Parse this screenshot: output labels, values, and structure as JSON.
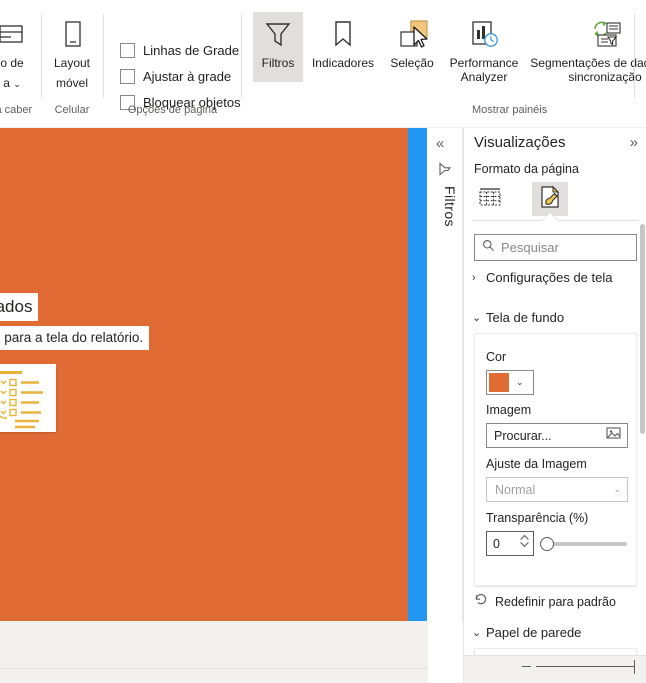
{
  "ribbon": {
    "groups": [
      {
        "label": "ra caber"
      },
      {
        "label": "Celular"
      },
      {
        "label": "Opções de página"
      },
      {
        "label": "Mostrar painéis"
      }
    ],
    "fit_button": {
      "line1": "o de",
      "line2": "a"
    },
    "mobile_layout": {
      "line1": "Layout",
      "line2": "móvel"
    },
    "checkboxes": [
      {
        "label": "Linhas de Grade",
        "checked": false
      },
      {
        "label": "Ajustar à grade",
        "checked": false
      },
      {
        "label": "Bloquear objetos",
        "checked": false
      }
    ],
    "buttons": [
      {
        "label": "Filtros",
        "icon": "funnel-icon",
        "selected": true
      },
      {
        "label": "Indicadores",
        "icon": "bookmark-icon",
        "selected": false
      },
      {
        "label": "Seleção",
        "icon": "selection-icon",
        "selected": false
      },
      {
        "label": "Performance Analyzer",
        "icon": "performance-analyzer-icon",
        "selected": false
      },
      {
        "label": "Segmentações de dados de sincronização",
        "icon": "sync-slicers-icon",
        "selected": false
      }
    ]
  },
  "canvas": {
    "background_color": "#e16b35",
    "selection_bar_color": "#2196f3",
    "title": "eus dados",
    "subtitle": "ampos para a tela do relatório.",
    "card_icon": "fields-list-illustration"
  },
  "filters_rail": {
    "collapse_icon": "chevron-double-left-icon",
    "filter_icon": "filter-funnel-icon",
    "label": "Filtros"
  },
  "visualizations": {
    "title": "Visualizações",
    "expand_icon": "chevron-double-right-icon",
    "subtitle": "Formato da página",
    "tabs": [
      {
        "name": "fields-tab",
        "icon": "table-fields-icon",
        "selected": false
      },
      {
        "name": "format-tab",
        "icon": "paintbrush-page-icon",
        "selected": true
      }
    ],
    "search": {
      "placeholder": "Pesquisar",
      "value": "",
      "icon": "search-icon"
    },
    "sections": [
      {
        "id": "screen-settings",
        "label": "Configurações de tela",
        "expanded": false,
        "chevron": "›"
      },
      {
        "id": "background",
        "label": "Tela de fundo",
        "expanded": true,
        "chevron": "⌄"
      },
      {
        "id": "wallpaper",
        "label": "Papel de parede",
        "expanded": true,
        "chevron": "⌄"
      }
    ],
    "background": {
      "color_label": "Cor",
      "color_value": "#e16b35",
      "color_chevron": "⌄",
      "image_label": "Imagem",
      "image_button": "Procurar...",
      "image_button_icon": "picture-browse-icon",
      "fit_label": "Ajuste da Imagem",
      "fit_value": "Normal",
      "fit_chevron": "⌄",
      "transparency_label": "Transparência (%)",
      "transparency_value": "0",
      "transparency_slider_percent": 0
    },
    "reset": {
      "label": "Redefinir para padrão",
      "icon": "reset-arrow-icon"
    }
  }
}
